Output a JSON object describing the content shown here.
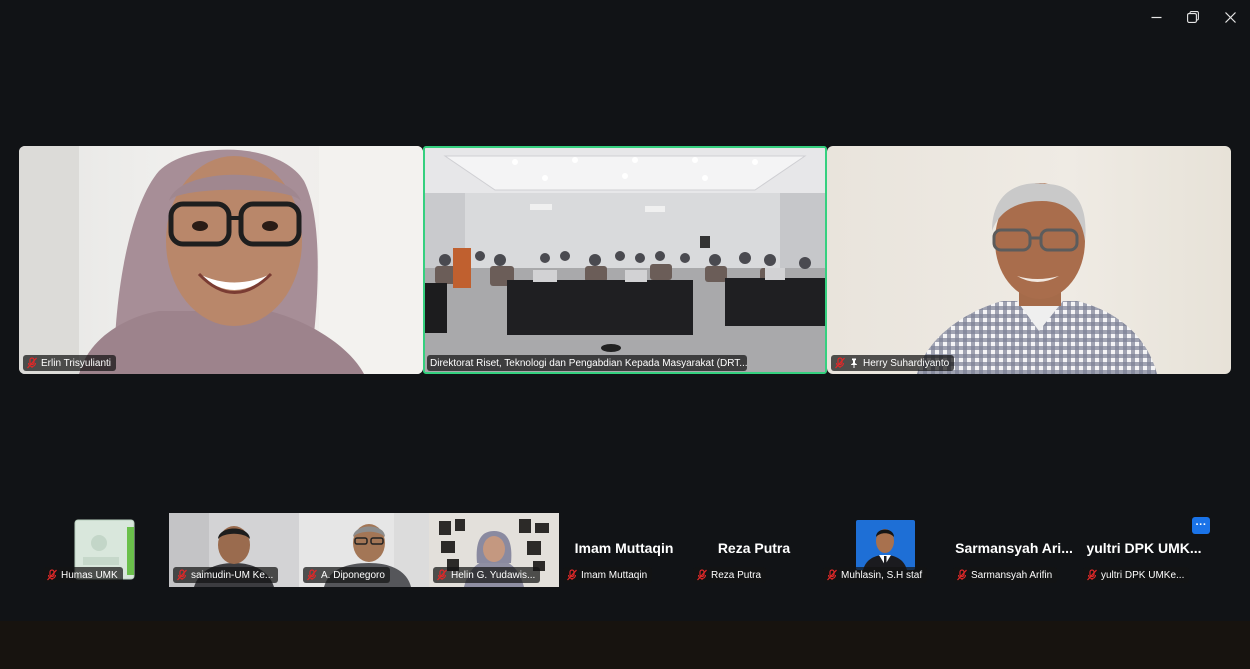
{
  "window": {
    "controls": [
      "minimize-icon",
      "restore-icon",
      "close-icon"
    ]
  },
  "main_tiles": [
    {
      "name": "Erlin Trisyulianti",
      "muted": true,
      "pinned": false,
      "active_speaker": false
    },
    {
      "name": "Direktorat Riset, Teknologi dan Pengabdian Kepada Masyarakat (DRT...",
      "muted": false,
      "pinned": false,
      "active_speaker": true
    },
    {
      "name": "Herry Suhardiyanto",
      "muted": true,
      "pinned": true,
      "active_speaker": false
    }
  ],
  "strip": [
    {
      "name": "Humas UMK",
      "video": true
    },
    {
      "name": "saimudin-UM Ke...",
      "video": true
    },
    {
      "name": "A. Diponegoro",
      "video": true
    },
    {
      "name": "Helin G. Yudawis...",
      "video": true
    },
    {
      "name": "Imam Muttaqin",
      "big_name": "Imam Muttaqin",
      "video": false
    },
    {
      "name": "Reza Putra",
      "big_name": "Reza Putra",
      "video": false
    },
    {
      "name": "Muhlasin, S.H staf",
      "video": true
    },
    {
      "name": "Sarmansyah Arifin",
      "big_name": "Sarmansyah Ari...",
      "video": false
    },
    {
      "name": "yultri DPK UMKe...",
      "big_name": "yultri DPK UMK...",
      "video": false
    }
  ],
  "more_button": "···",
  "colors": {
    "background": "#111316",
    "active_speaker_border": "#35d07f",
    "mute_red": "#e02828",
    "accent_blue": "#1a73e8"
  }
}
